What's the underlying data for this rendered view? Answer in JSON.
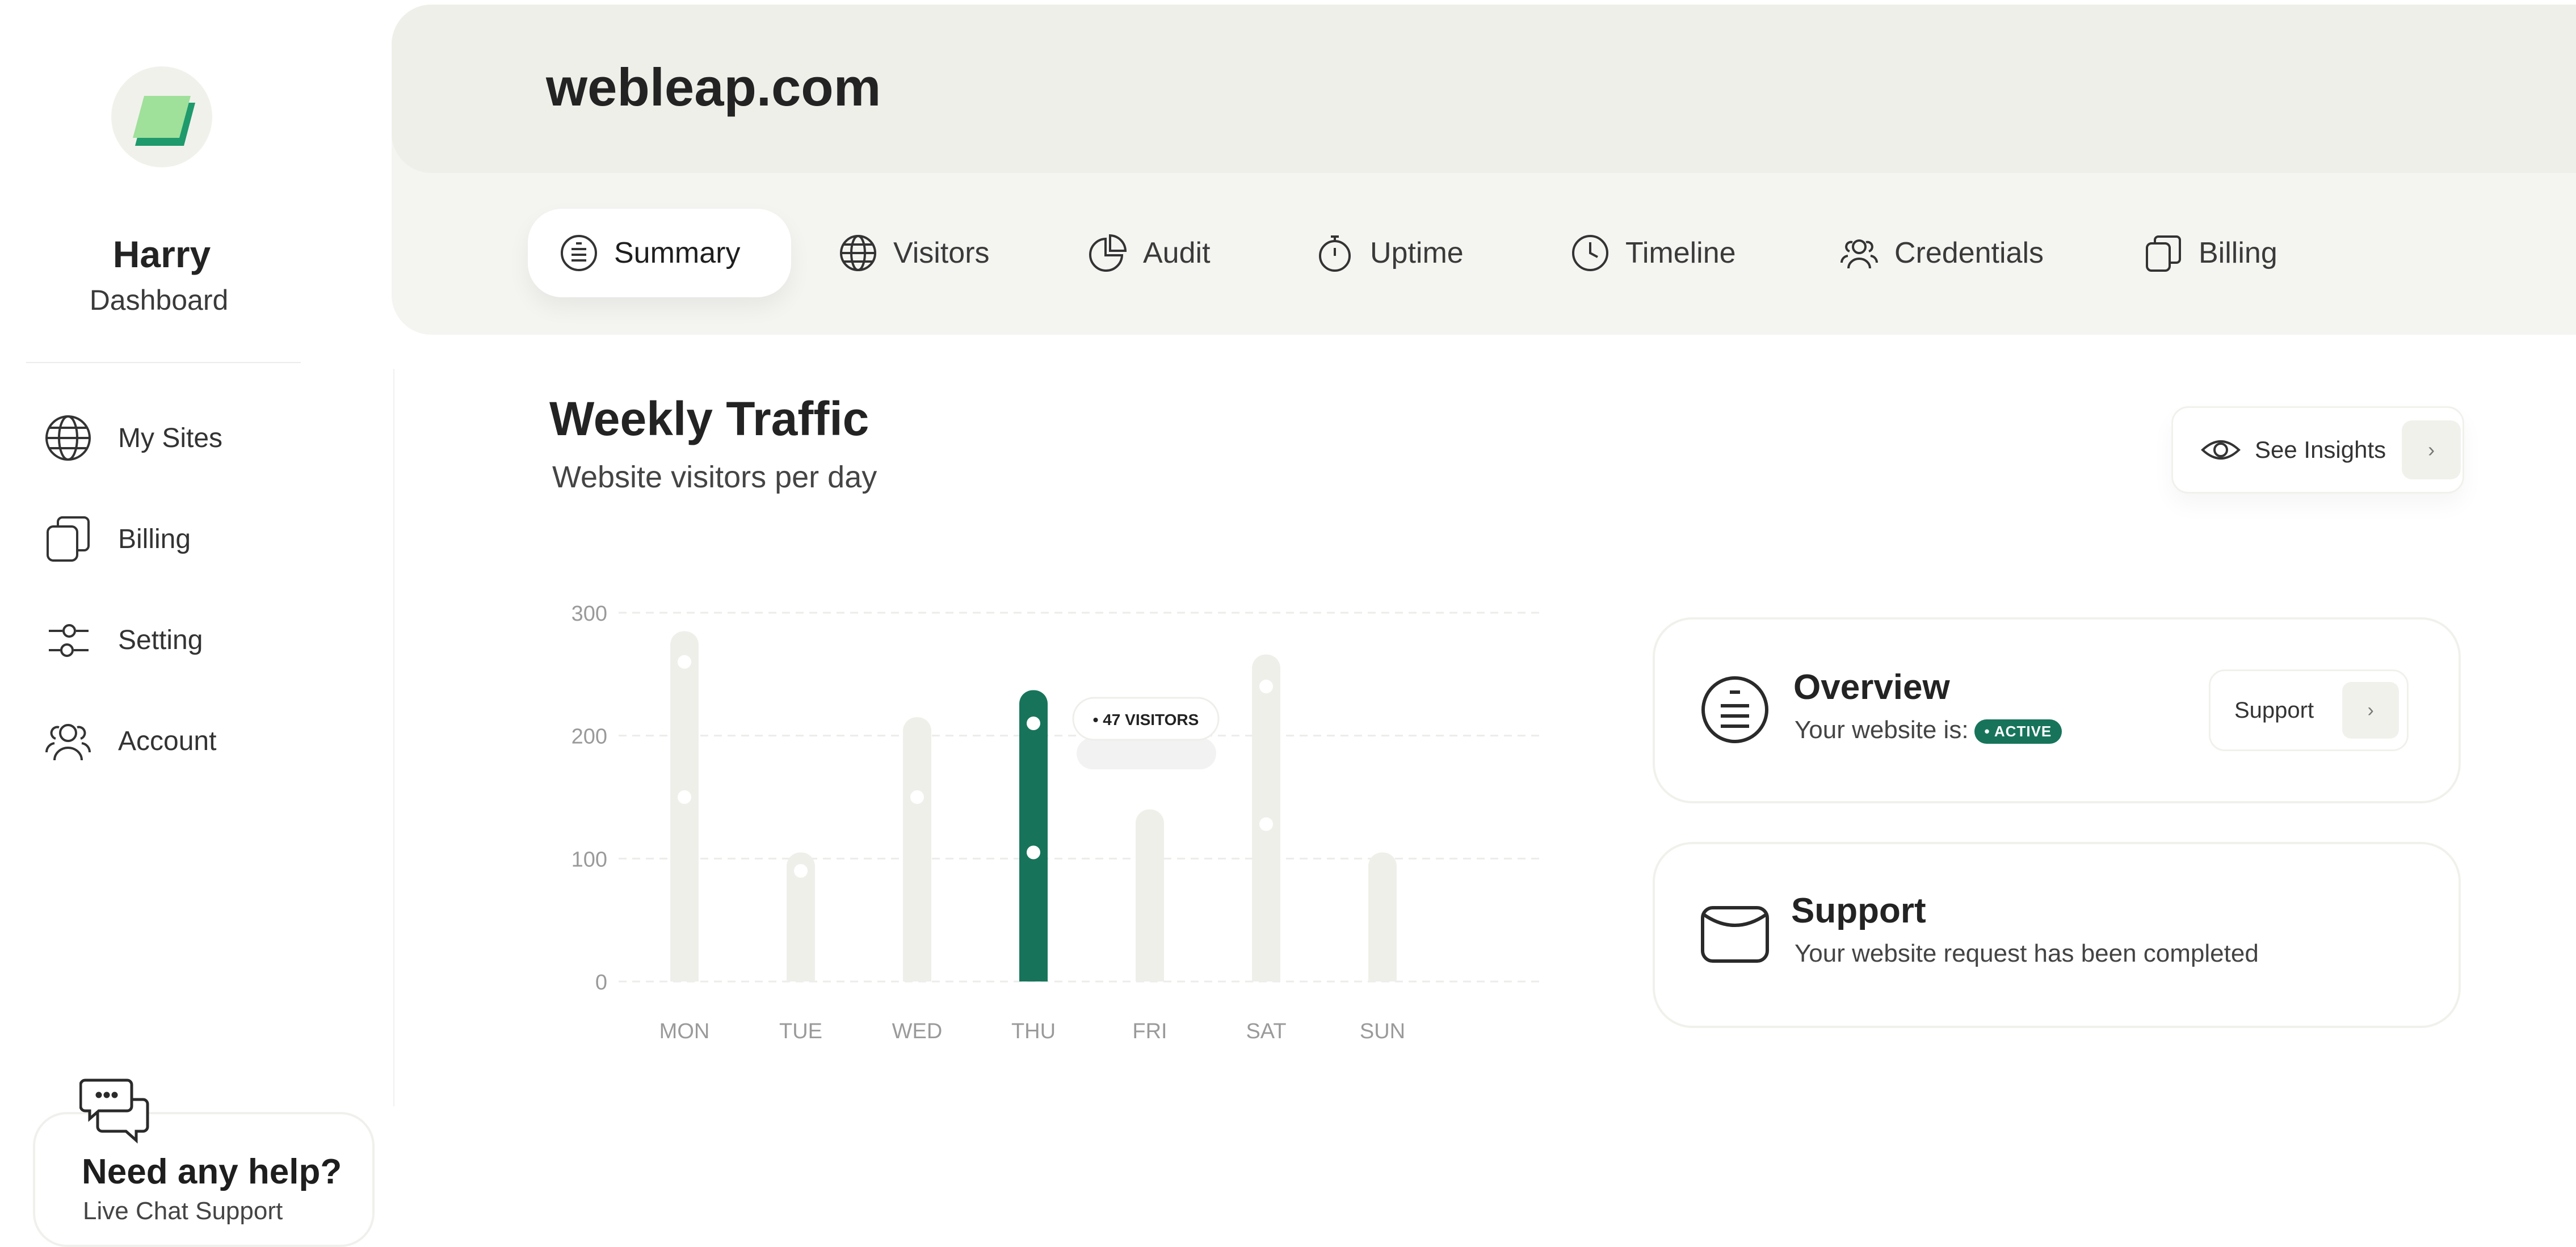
{
  "user": {
    "name": "Harry",
    "subtitle": "Dashboard"
  },
  "sidebar": {
    "items": [
      {
        "label": "My Sites",
        "icon": "globe-icon"
      },
      {
        "label": "Billing",
        "icon": "billing-icon"
      },
      {
        "label": "Setting",
        "icon": "sliders-icon"
      },
      {
        "label": "Account",
        "icon": "users-icon"
      }
    ],
    "help": {
      "title": "Need any help?",
      "subtitle": "Live Chat Support"
    }
  },
  "site": {
    "title": "webleap.com"
  },
  "tabs": [
    {
      "label": "Summary",
      "icon": "summary-icon",
      "active": true
    },
    {
      "label": "Visitors",
      "icon": "globe-icon"
    },
    {
      "label": "Audit",
      "icon": "pie-icon"
    },
    {
      "label": "Uptime",
      "icon": "stopwatch-icon"
    },
    {
      "label": "Timeline",
      "icon": "clock-icon"
    },
    {
      "label": "Credentials",
      "icon": "users-icon"
    },
    {
      "label": "Billing",
      "icon": "billing-icon"
    }
  ],
  "traffic": {
    "title": "Weekly Traffic",
    "subtitle": "Website visitors per day",
    "insights_label": "See Insights",
    "arrow": "›"
  },
  "overview": {
    "title": "Overview",
    "status_prefix": "Your website is:",
    "status_badge": "• ACTIVE",
    "support_label": "Support",
    "arrow": "›"
  },
  "support_card": {
    "title": "Support",
    "message": "Your website request has been completed"
  },
  "colors": {
    "accent": "#17745a",
    "bar": "#efefea",
    "logo_light": "#9fe09a",
    "logo_dark": "#1e9a6c"
  },
  "chart_data": {
    "type": "bar",
    "categories": [
      "MON",
      "TUE",
      "WED",
      "THU",
      "FRI",
      "SAT",
      "SUN"
    ],
    "values": [
      285,
      105,
      215,
      237,
      140,
      266,
      105
    ],
    "ylim": [
      0,
      300
    ],
    "yticks": [
      0,
      100,
      200,
      300
    ],
    "highlight_index": 3,
    "markers": [
      [
        260,
        150
      ],
      [
        90
      ],
      [
        150
      ],
      [
        210,
        105
      ],
      [],
      [
        240,
        128
      ],
      []
    ],
    "tooltip": {
      "label": "• 47 VISITORS",
      "index": 3
    },
    "grid": true
  }
}
